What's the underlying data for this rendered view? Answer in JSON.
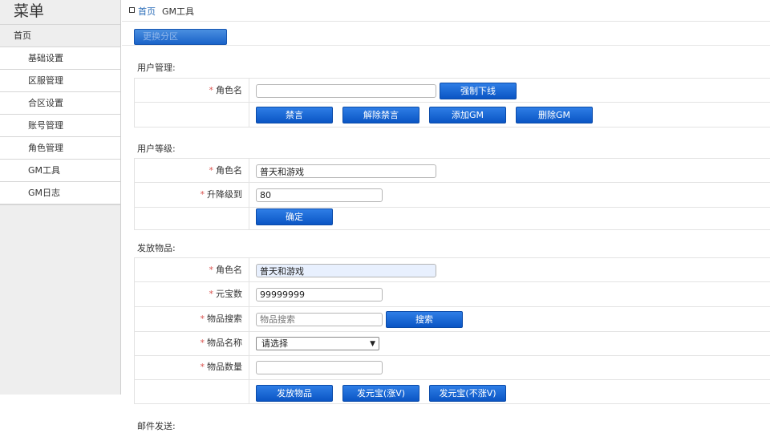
{
  "sidebar": {
    "title": "菜单",
    "home": "首页",
    "items": [
      {
        "label": "基础设置"
      },
      {
        "label": "区服管理"
      },
      {
        "label": "合区设置"
      },
      {
        "label": "账号管理"
      },
      {
        "label": "角色管理"
      },
      {
        "label": "GM工具"
      },
      {
        "label": "GM日志"
      }
    ]
  },
  "breadcrumb": {
    "home": "首页",
    "current": "GM工具"
  },
  "zone_button": "更换分区",
  "user_management": {
    "title": "用户管理:",
    "role_label": "角色名",
    "role_value": "",
    "kick_button": "强制下线",
    "buttons": [
      "禁言",
      "解除禁言",
      "添加GM",
      "删除GM"
    ]
  },
  "user_level": {
    "title": "用户等级:",
    "role_label": "角色名",
    "role_value": "普天和游戏",
    "level_label": "升降级到",
    "level_value": "80",
    "confirm_button": "确定"
  },
  "send_items": {
    "title": "发放物品:",
    "role_label": "角色名",
    "role_value": "普天和游戏",
    "yuanbao_label": "元宝数",
    "yuanbao_value": "99999999",
    "search_label": "物品搜索",
    "search_placeholder": "物品搜索",
    "search_button": "搜索",
    "item_name_label": "物品名称",
    "item_name_selected": "请选择",
    "item_qty_label": "物品数量",
    "item_qty_value": "",
    "buttons": [
      "发放物品",
      "发元宝(涨V)",
      "发元宝(不涨V)"
    ]
  },
  "mail": {
    "title": "邮件发送:"
  },
  "colors": {
    "accent": "#0a55c4",
    "required": "#d9534f",
    "link": "#2a6cb8"
  }
}
